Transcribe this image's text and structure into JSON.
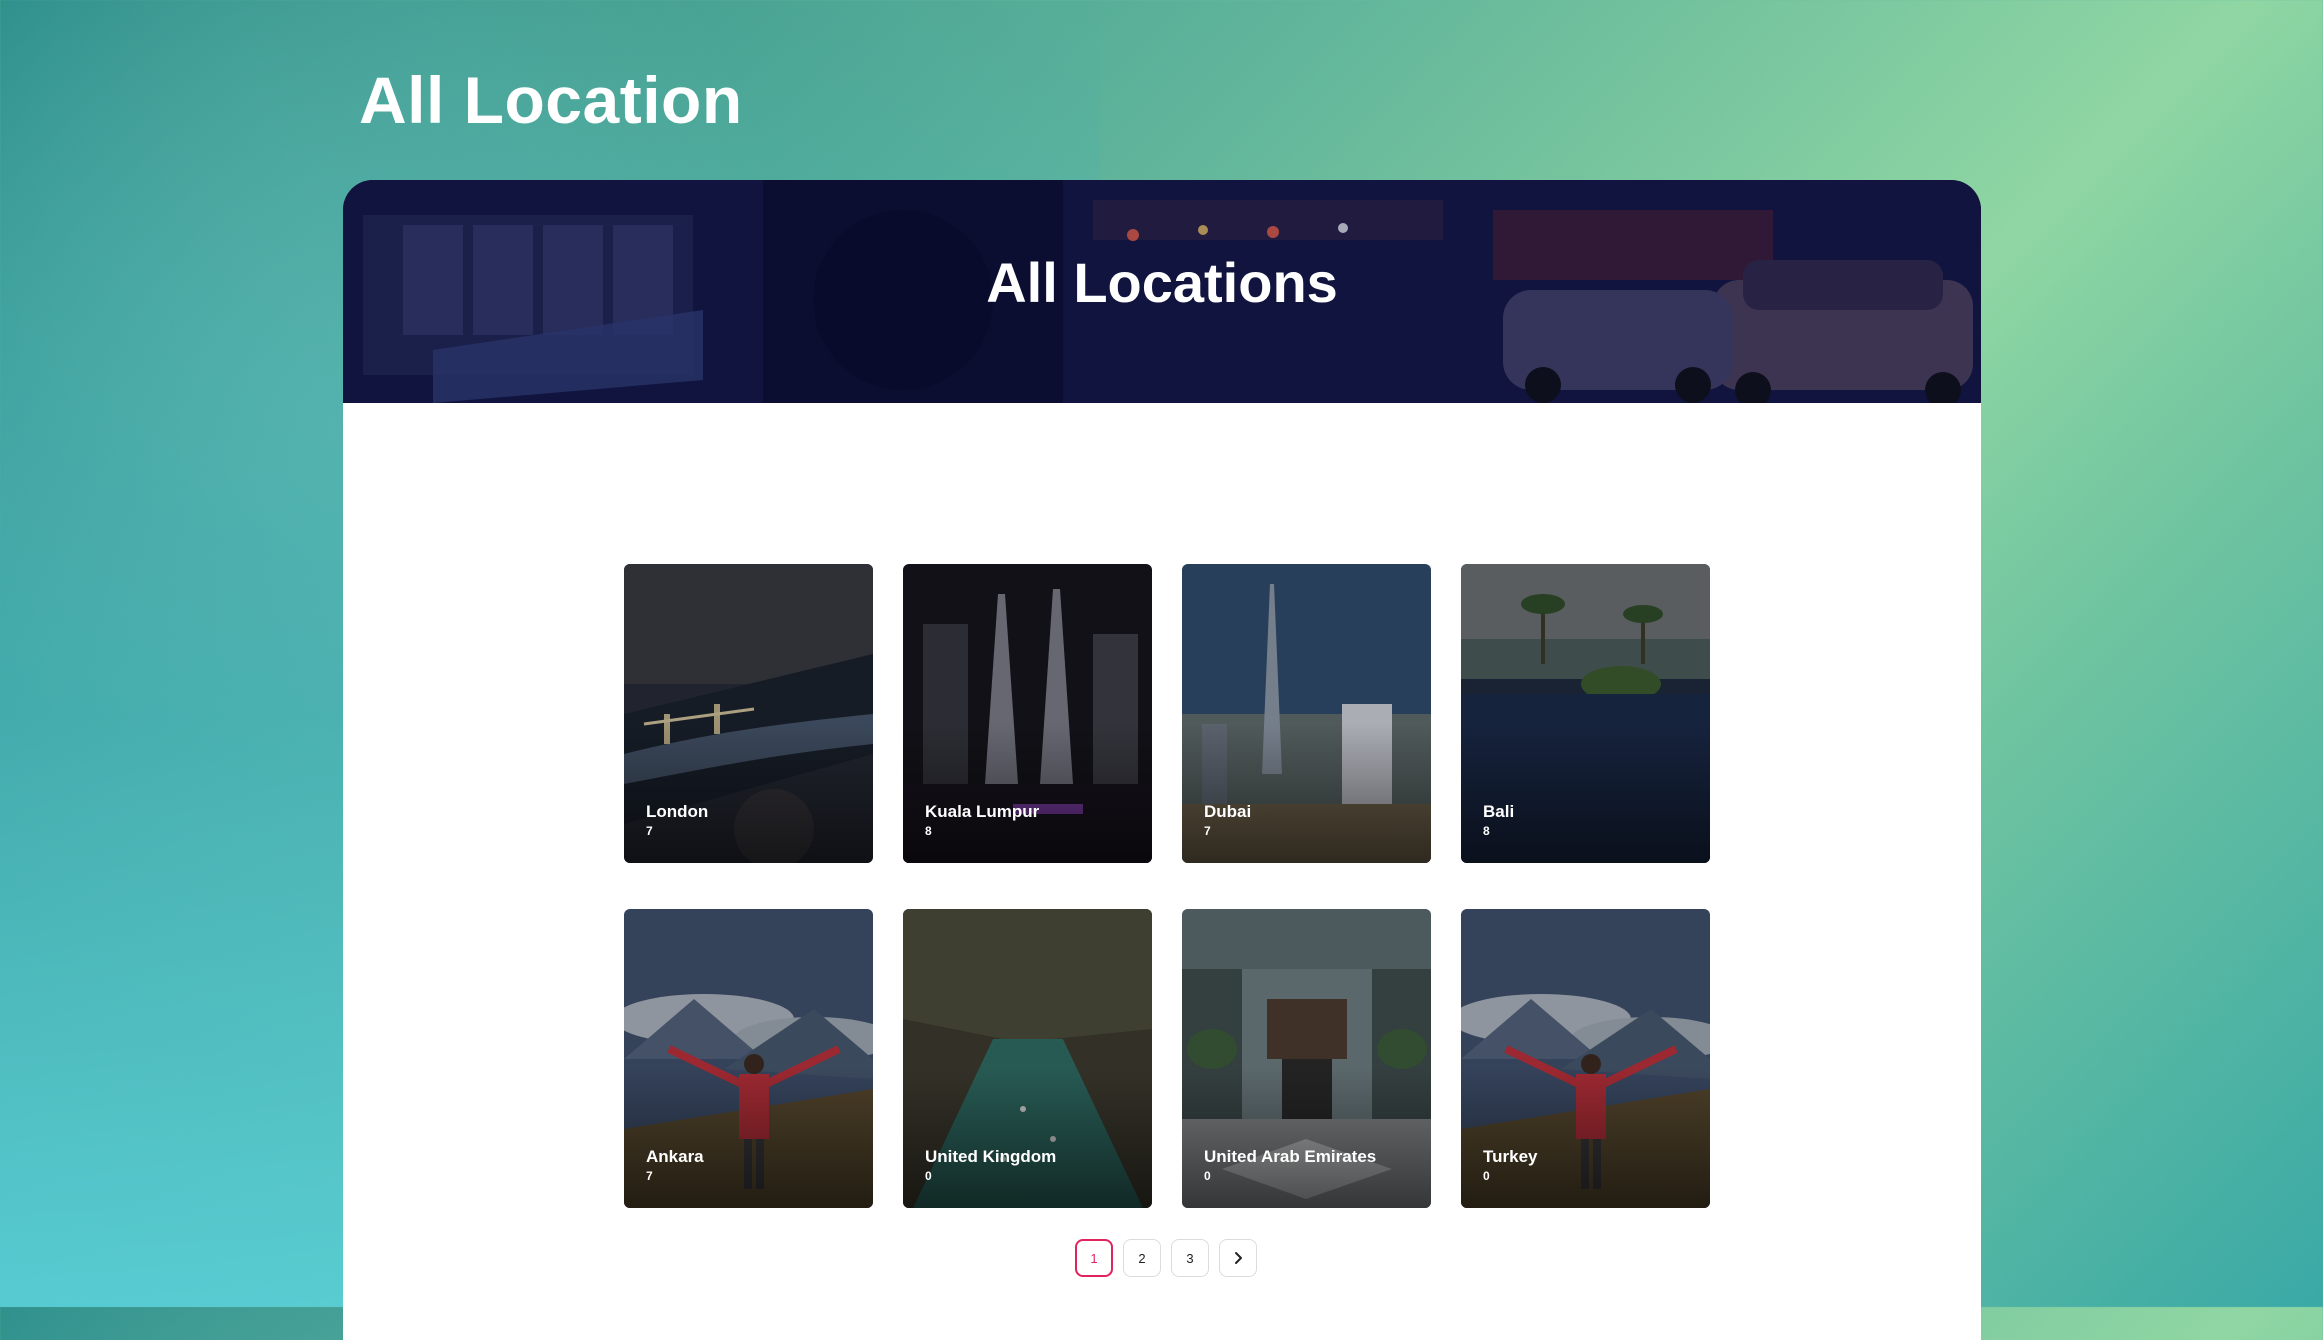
{
  "page": {
    "heading": "All Location"
  },
  "hero": {
    "title": "All Locations"
  },
  "locations": [
    {
      "name": "London",
      "count": "7"
    },
    {
      "name": "Kuala Lumpur",
      "count": "8"
    },
    {
      "name": "Dubai",
      "count": "7"
    },
    {
      "name": "Bali",
      "count": "8"
    },
    {
      "name": "Ankara",
      "count": "7"
    },
    {
      "name": "United Kingdom",
      "count": "0"
    },
    {
      "name": "United Arab Emirates",
      "count": "0"
    },
    {
      "name": "Turkey",
      "count": "0"
    }
  ],
  "pagination": {
    "pages": [
      "1",
      "2",
      "3"
    ],
    "current": "1",
    "next_icon": "chevron-right-icon"
  },
  "colors": {
    "accent": "#e0245e",
    "heading_text": "#ffffff"
  }
}
